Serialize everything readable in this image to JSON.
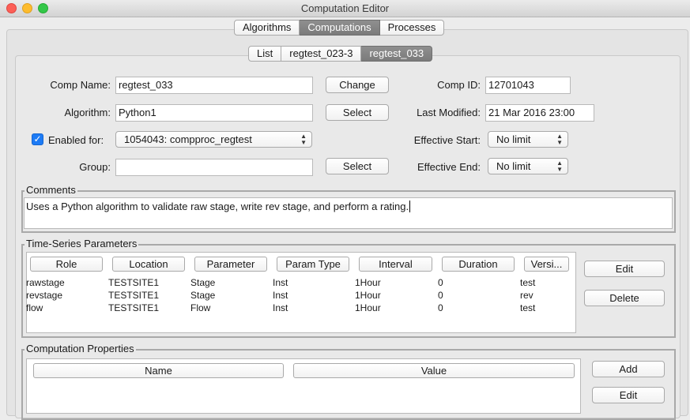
{
  "window": {
    "title": "Computation Editor"
  },
  "main_tabs": [
    {
      "label": "Algorithms",
      "selected": false
    },
    {
      "label": "Computations",
      "selected": true
    },
    {
      "label": "Processes",
      "selected": false
    }
  ],
  "sub_tabs": [
    {
      "label": "List",
      "selected": false
    },
    {
      "label": "regtest_023-3",
      "selected": false
    },
    {
      "label": "regtest_033",
      "selected": true
    }
  ],
  "form": {
    "comp_name_label": "Comp Name:",
    "comp_name_value": "regtest_033",
    "change_button": "Change",
    "comp_id_label": "Comp ID:",
    "comp_id_value": "12701043",
    "algorithm_label": "Algorithm:",
    "algorithm_value": "Python1",
    "algorithm_select_button": "Select",
    "last_modified_label": "Last Modified:",
    "last_modified_value": "21 Mar 2016 23:00",
    "enabled_for_label": "Enabled for:",
    "enabled_for_checked": true,
    "enabled_for_value": "1054043: compproc_regtest",
    "effective_start_label": "Effective Start:",
    "effective_start_value": "No limit",
    "group_label": "Group:",
    "group_value": "",
    "group_select_button": "Select",
    "effective_end_label": "Effective End:",
    "effective_end_value": "No limit"
  },
  "comments": {
    "title": "Comments",
    "text": "Uses a Python algorithm to validate raw stage, write rev stage, and perform a rating."
  },
  "ts_params": {
    "title": "Time-Series Parameters",
    "columns": [
      "Role",
      "Location",
      "Parameter",
      "Param Type",
      "Interval",
      "Duration",
      "Versi..."
    ],
    "rows": [
      [
        "rawstage",
        "TESTSITE1",
        "Stage",
        "Inst",
        "1Hour",
        "0",
        "test"
      ],
      [
        "revstage",
        "TESTSITE1",
        "Stage",
        "Inst",
        "1Hour",
        "0",
        "rev"
      ],
      [
        "flow",
        "TESTSITE1",
        "Flow",
        "Inst",
        "1Hour",
        "0",
        "test"
      ]
    ],
    "edit_button": "Edit",
    "delete_button": "Delete"
  },
  "comp_props": {
    "title": "Computation Properties",
    "columns": [
      "Name",
      "Value"
    ],
    "add_button": "Add",
    "edit_button": "Edit"
  }
}
